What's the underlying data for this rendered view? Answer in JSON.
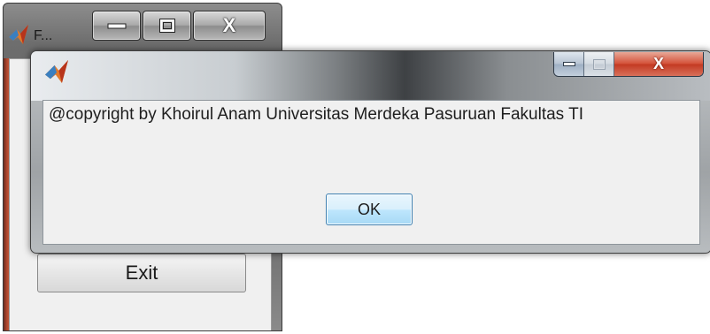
{
  "background_window": {
    "title": "F...",
    "controls": {
      "minimize_icon": "minimize-icon",
      "maximize_icon": "maximize-icon",
      "close_label": "X"
    },
    "exit_button_label": "Exit"
  },
  "dialog": {
    "app_icon": "matlab-icon",
    "controls": {
      "minimize_icon": "minimize-icon",
      "maximize_icon": "maximize-icon",
      "close_label": "X"
    },
    "message": "@copyright by Khoirul Anam Universitas Merdeka Pasuruan Fakultas TI",
    "ok_button_label": "OK",
    "close_button_color": "#c33a22",
    "ok_button_border_color": "#3c7fb1"
  }
}
